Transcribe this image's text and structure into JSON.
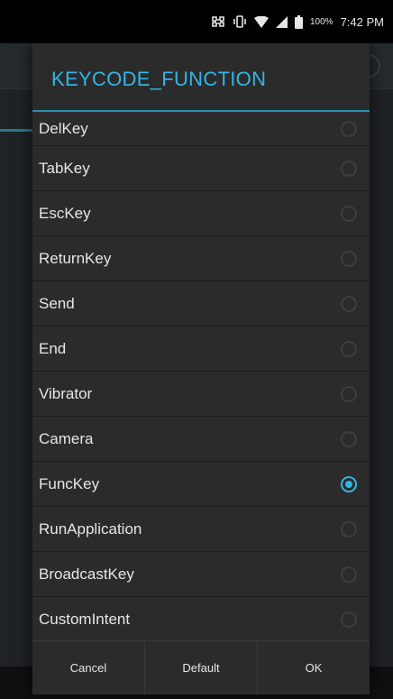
{
  "status_bar": {
    "battery_percent": "100%",
    "time": "7:42 PM",
    "icons": [
      "nfc-icon",
      "vibrate-icon",
      "wifi-icon",
      "signal-icon",
      "battery-icon"
    ]
  },
  "dialog": {
    "title": "KEYCODE_FUNCTION",
    "accent_color": "#33b5e5",
    "options": [
      {
        "label": "DelKey",
        "selected": false
      },
      {
        "label": "TabKey",
        "selected": false
      },
      {
        "label": "EscKey",
        "selected": false
      },
      {
        "label": "ReturnKey",
        "selected": false
      },
      {
        "label": "Send",
        "selected": false
      },
      {
        "label": "End",
        "selected": false
      },
      {
        "label": "Vibrator",
        "selected": false
      },
      {
        "label": "Camera",
        "selected": false
      },
      {
        "label": "FuncKey",
        "selected": true
      },
      {
        "label": "RunApplication",
        "selected": false
      },
      {
        "label": "BroadcastKey",
        "selected": false
      },
      {
        "label": "CustomIntent",
        "selected": false
      }
    ],
    "buttons": {
      "cancel": "Cancel",
      "default": "Default",
      "ok": "OK"
    }
  }
}
